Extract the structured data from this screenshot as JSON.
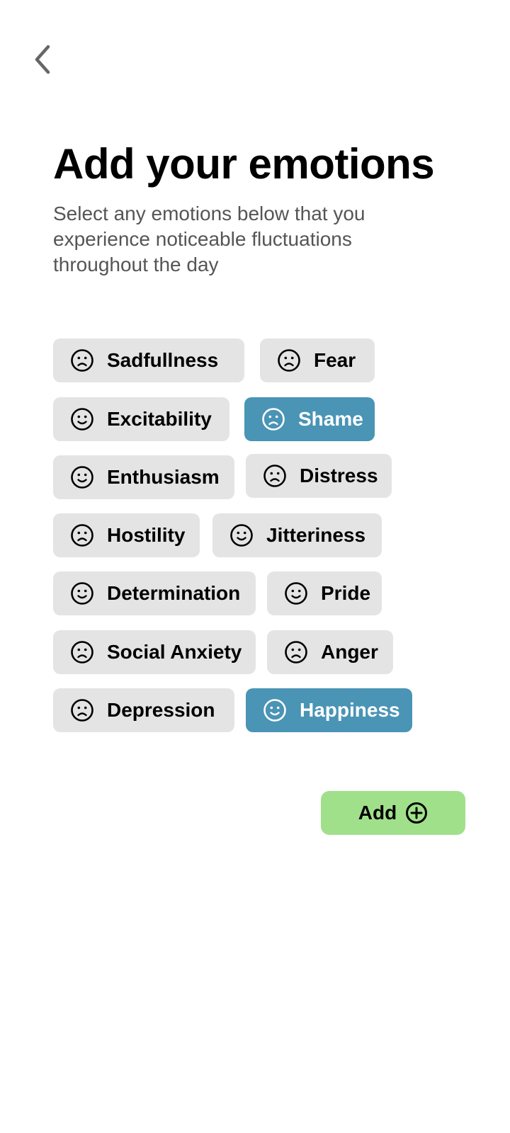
{
  "header": {
    "back_icon": "chevron-left-icon",
    "title": "Add your emotions",
    "subtitle": "Select any emotions below that you experience noticeable fluctuations throughout the day"
  },
  "emotions": [
    {
      "label": "Sadfullness",
      "face": "sad",
      "selected": false
    },
    {
      "label": "Fear",
      "face": "sad",
      "selected": false
    },
    {
      "label": "Excitability",
      "face": "happy",
      "selected": false
    },
    {
      "label": "Shame",
      "face": "sad",
      "selected": true
    },
    {
      "label": "Enthusiasm",
      "face": "happy",
      "selected": false
    },
    {
      "label": "Distress",
      "face": "sad",
      "selected": false
    },
    {
      "label": "Hostility",
      "face": "sad",
      "selected": false
    },
    {
      "label": "Jitteriness",
      "face": "happy",
      "selected": false
    },
    {
      "label": "Determination",
      "face": "happy",
      "selected": false
    },
    {
      "label": "Pride",
      "face": "happy",
      "selected": false
    },
    {
      "label": "Social Anxiety",
      "face": "sad",
      "selected": false
    },
    {
      "label": "Anger",
      "face": "sad",
      "selected": false
    },
    {
      "label": "Depression",
      "face": "sad",
      "selected": false
    },
    {
      "label": "Happiness",
      "face": "happy",
      "selected": true
    }
  ],
  "add_button": {
    "label": "Add",
    "icon": "plus-circle-icon"
  },
  "colors": {
    "chip_default": "#e4e4e4",
    "chip_selected": "#4a94b5",
    "add_button": "#a1e08b",
    "subtitle_text": "#555555"
  }
}
